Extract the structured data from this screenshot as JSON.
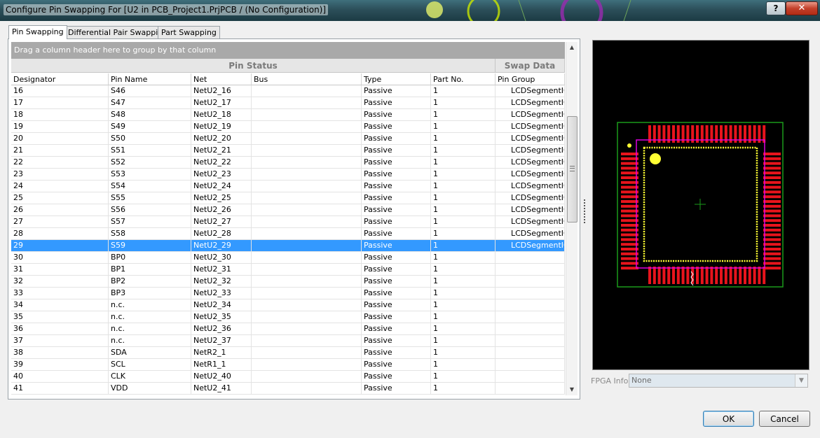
{
  "window": {
    "title": "Configure Pin Swapping For [U2 in PCB_Project1.PrjPCB / (No Configuration)]",
    "help_label": "?",
    "close_label": "✕"
  },
  "tabs": [
    {
      "label": "Pin Swapping",
      "active": true
    },
    {
      "label": "Differential Pair Swapping",
      "active": false
    },
    {
      "label": "Part Swapping",
      "active": false
    }
  ],
  "grid": {
    "group_hint": "Drag a column header here to group by that column",
    "bands": {
      "pin_status": "Pin Status",
      "swap_data": "Swap Data"
    },
    "columns": [
      "Designator",
      "Pin Name",
      "Net",
      "Bus",
      "Type",
      "Part No.",
      "Pin Group"
    ],
    "selected_row": 13,
    "rows": [
      [
        "16",
        "S46",
        "NetU2_16",
        "",
        "Passive",
        "1",
        "LCDSegmentIO"
      ],
      [
        "17",
        "S47",
        "NetU2_17",
        "",
        "Passive",
        "1",
        "LCDSegmentIO"
      ],
      [
        "18",
        "S48",
        "NetU2_18",
        "",
        "Passive",
        "1",
        "LCDSegmentIO"
      ],
      [
        "19",
        "S49",
        "NetU2_19",
        "",
        "Passive",
        "1",
        "LCDSegmentIO"
      ],
      [
        "20",
        "S50",
        "NetU2_20",
        "",
        "Passive",
        "1",
        "LCDSegmentIO"
      ],
      [
        "21",
        "S51",
        "NetU2_21",
        "",
        "Passive",
        "1",
        "LCDSegmentIO"
      ],
      [
        "22",
        "S52",
        "NetU2_22",
        "",
        "Passive",
        "1",
        "LCDSegmentIO"
      ],
      [
        "23",
        "S53",
        "NetU2_23",
        "",
        "Passive",
        "1",
        "LCDSegmentIO"
      ],
      [
        "24",
        "S54",
        "NetU2_24",
        "",
        "Passive",
        "1",
        "LCDSegmentIO"
      ],
      [
        "25",
        "S55",
        "NetU2_25",
        "",
        "Passive",
        "1",
        "LCDSegmentIO"
      ],
      [
        "26",
        "S56",
        "NetU2_26",
        "",
        "Passive",
        "1",
        "LCDSegmentIO"
      ],
      [
        "27",
        "S57",
        "NetU2_27",
        "",
        "Passive",
        "1",
        "LCDSegmentIO"
      ],
      [
        "28",
        "S58",
        "NetU2_28",
        "",
        "Passive",
        "1",
        "LCDSegmentIO"
      ],
      [
        "29",
        "S59",
        "NetU2_29",
        "",
        "Passive",
        "1",
        "LCDSegmentIO"
      ],
      [
        "30",
        "BP0",
        "NetU2_30",
        "",
        "Passive",
        "1",
        ""
      ],
      [
        "31",
        "BP1",
        "NetU2_31",
        "",
        "Passive",
        "1",
        ""
      ],
      [
        "32",
        "BP2",
        "NetU2_32",
        "",
        "Passive",
        "1",
        ""
      ],
      [
        "33",
        "BP3",
        "NetU2_33",
        "",
        "Passive",
        "1",
        ""
      ],
      [
        "34",
        "n.c.",
        "NetU2_34",
        "",
        "Passive",
        "1",
        ""
      ],
      [
        "35",
        "n.c.",
        "NetU2_35",
        "",
        "Passive",
        "1",
        ""
      ],
      [
        "36",
        "n.c.",
        "NetU2_36",
        "",
        "Passive",
        "1",
        ""
      ],
      [
        "37",
        "n.c.",
        "NetU2_37",
        "",
        "Passive",
        "1",
        ""
      ],
      [
        "38",
        "SDA",
        "NetR2_1",
        "",
        "Passive",
        "1",
        ""
      ],
      [
        "39",
        "SCL",
        "NetR1_1",
        "",
        "Passive",
        "1",
        ""
      ],
      [
        "40",
        "CLK",
        "NetU2_40",
        "",
        "Passive",
        "1",
        ""
      ],
      [
        "41",
        "VDD",
        "NetU2_41",
        "",
        "Passive",
        "1",
        ""
      ]
    ]
  },
  "fpga": {
    "label": "FPGA Info",
    "value": "None"
  },
  "buttons": {
    "ok": "OK",
    "cancel": "Cancel"
  },
  "colors": {
    "selection": "#3399ff",
    "pad": "#e8141c",
    "silkscreen": "#ffff33",
    "courtyard": "#e000e0",
    "board_outline": "#1a9a1a"
  }
}
